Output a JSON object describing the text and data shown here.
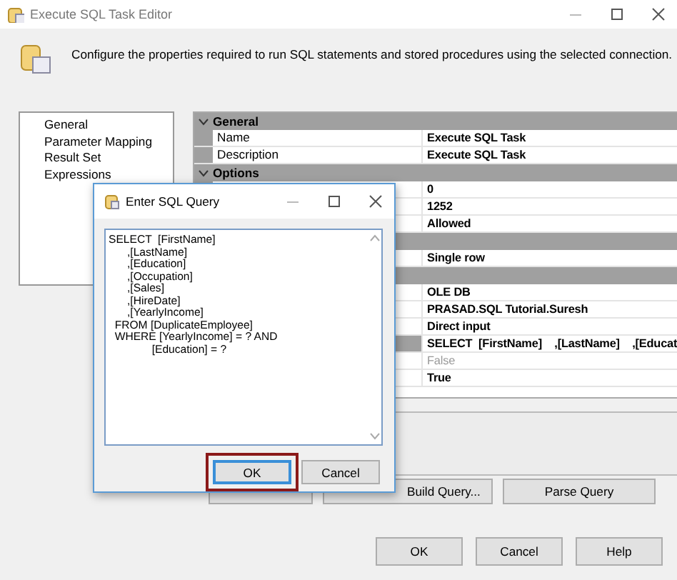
{
  "window": {
    "title": "Execute SQL Task Editor"
  },
  "header": {
    "description": "Configure the properties required to run SQL statements and stored procedures using the selected connection."
  },
  "nav": {
    "items": [
      {
        "label": "General"
      },
      {
        "label": "Parameter Mapping"
      },
      {
        "label": "Result Set"
      },
      {
        "label": "Expressions"
      }
    ]
  },
  "grid": {
    "groups": [
      {
        "title": "General",
        "expanded": true,
        "rows": [
          {
            "name": "Name",
            "value": "Execute SQL Task",
            "selected": false,
            "disabled": false
          },
          {
            "name": "Description",
            "value": "Execute SQL Task",
            "selected": false,
            "disabled": false
          }
        ]
      },
      {
        "title": "Options",
        "expanded": true,
        "rows": [
          {
            "value": "0",
            "selected": false,
            "disabled": false
          },
          {
            "value": "1252",
            "selected": false,
            "disabled": false
          },
          {
            "value": "Allowed",
            "selected": false,
            "disabled": false
          }
        ]
      },
      {
        "rows": [
          {
            "value": "Single row",
            "selected": false,
            "disabled": false
          }
        ]
      },
      {
        "rows": [
          {
            "value": "OLE DB",
            "selected": false,
            "disabled": false
          },
          {
            "value": "PRASAD.SQL Tutorial.Suresh",
            "selected": false,
            "disabled": false
          },
          {
            "value": "Direct input",
            "selected": false,
            "disabled": false
          },
          {
            "value": "SELECT  [FirstName]    ,[LastName]    ,[Educat",
            "selected": true,
            "disabled": false
          },
          {
            "value": "False",
            "selected": false,
            "disabled": true
          },
          {
            "value": "True",
            "selected": false,
            "disabled": false
          }
        ]
      }
    ]
  },
  "query_buttons": [
    {
      "kind": "covered"
    },
    {
      "kind": "labelled",
      "label": "Build Query..."
    },
    {
      "kind": "labelled",
      "label": "Parse Query"
    }
  ],
  "footer_buttons": [
    "OK",
    "Cancel",
    "Help"
  ],
  "dialog": {
    "title": "Enter SQL Query",
    "query": "SELECT  [FirstName]\n      ,[LastName]\n      ,[Education]\n      ,[Occupation]\n      ,[Sales]\n      ,[HireDate]\n      ,[YearlyIncome]\n  FROM [DuplicateEmployee]\n  WHERE [YearlyIncome] = ? AND\n              [Education] = ?",
    "buttons": [
      {
        "label": "OK",
        "highlighted": true
      },
      {
        "label": "Cancel",
        "highlighted": false
      }
    ]
  }
}
